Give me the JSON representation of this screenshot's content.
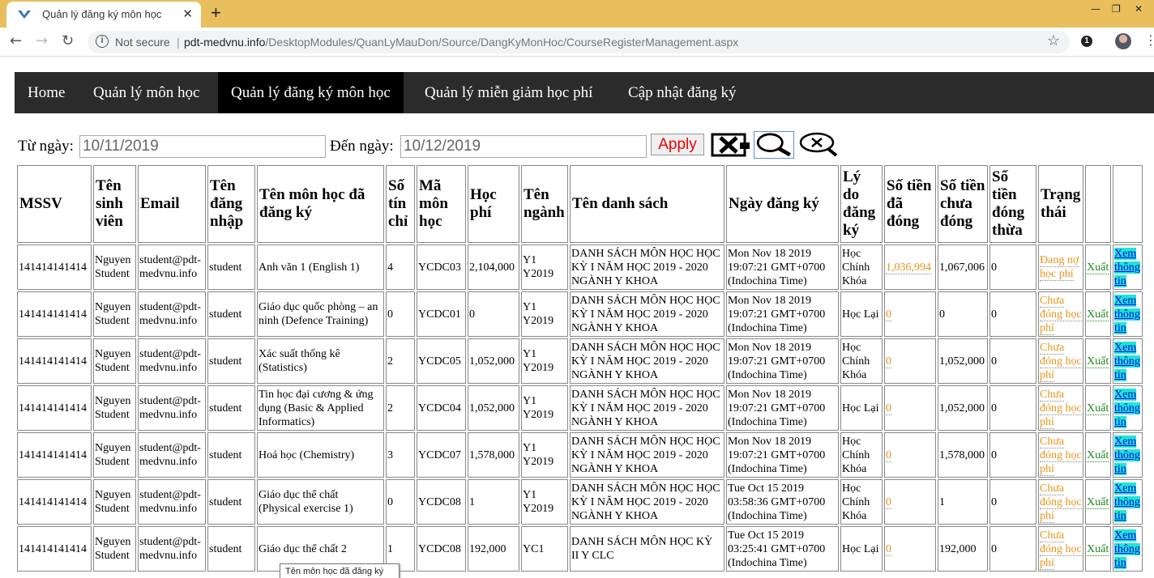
{
  "browser": {
    "tab_title": "Quản lý đăng ký môn học",
    "tab_close": "✕",
    "new_tab": "+",
    "controls": {
      "minimize": "—",
      "restore": "❐",
      "close": "✕"
    },
    "not_secure": "Not secure",
    "url_host": "pdt-medvnu.info",
    "url_path": "/DesktopModules/QuanLyMauDon/Source/DangKyMonHoc/CourseRegisterManagement.aspx",
    "extension_badge": "1"
  },
  "nav": {
    "items": [
      "Home",
      "Quản lý môn học",
      "Quản lý đăng ký môn học",
      "Quản lý miễn giảm học phí",
      "Cập nhật đăng ký"
    ],
    "active_index": 2
  },
  "filter": {
    "from_label": "Từ ngày:",
    "from_value": "10/11/2019",
    "to_label": "Đến ngày:",
    "to_value": "10/12/2019",
    "apply_label": "Apply"
  },
  "table": {
    "headers": [
      "MSSV",
      "Tên sinh viên",
      "Email",
      "Tên đăng nhập",
      "Tên môn học đã đăng ký",
      "Số tín chỉ",
      "Mã môn học",
      "Học phí",
      "Tên ngành",
      "Tên danh sách",
      "Ngày đăng ký",
      "Lý do đăng ký",
      "Số tiền đã đóng",
      "Số tiền chưa đóng",
      "Số tiền đóng thừa",
      "Trạng thái",
      "",
      ""
    ],
    "rows": [
      {
        "mssv": "141414141414",
        "name": "Nguyen Student",
        "email": "student@pdt-medvnu.info",
        "username": "student",
        "course": "Anh văn 1 (English 1)",
        "credits": "4",
        "code": "YCDC03",
        "fee": "2,104,000",
        "major": "Y1 Y2019",
        "list": "DANH SÁCH MÔN HỌC HỌC KỲ I NĂM HỌC 2019 - 2020 NGÀNH Y KHOA",
        "date": "Mon Nov 18 2019 19:07:21 GMT+0700 (Indochina Time)",
        "reason": "Học Chính Khóa",
        "paid": "1,036,994",
        "unpaid": "1,067,006",
        "overpaid": "0",
        "status": "Đang nợ học phí",
        "export": "Xuất",
        "view": "Xem thông tin"
      },
      {
        "mssv": "141414141414",
        "name": "Nguyen Student",
        "email": "student@pdt-medvnu.info",
        "username": "student",
        "course": "Giáo dục quốc phòng – an ninh (Defence Training)",
        "credits": "0",
        "code": "YCDC01",
        "fee": "0",
        "major": "Y1 Y2019",
        "list": "DANH SÁCH MÔN HỌC HỌC KỲ I NĂM HỌC 2019 - 2020 NGÀNH Y KHOA",
        "date": "Mon Nov 18 2019 19:07:21 GMT+0700 (Indochina Time)",
        "reason": "Học Lại",
        "paid": "0",
        "unpaid": "0",
        "overpaid": "0",
        "status": "Chưa đóng học phí",
        "export": "Xuất",
        "view": "Xem thông tin"
      },
      {
        "mssv": "141414141414",
        "name": "Nguyen Student",
        "email": "student@pdt-medvnu.info",
        "username": "student",
        "course": "Xác suất thống kê (Statistics)",
        "credits": "2",
        "code": "YCDC05",
        "fee": "1,052,000",
        "major": "Y1 Y2019",
        "list": "DANH SÁCH MÔN HỌC HỌC KỲ I NĂM HỌC 2019 - 2020 NGÀNH Y KHOA",
        "date": "Mon Nov 18 2019 19:07:21 GMT+0700 (Indochina Time)",
        "reason": "Học Chính Khóa",
        "paid": "0",
        "unpaid": "1,052,000",
        "overpaid": "0",
        "status": "Chưa đóng học phí",
        "export": "Xuất",
        "view": "Xem thông tin"
      },
      {
        "mssv": "141414141414",
        "name": "Nguyen Student",
        "email": "student@pdt-medvnu.info",
        "username": "student",
        "course": "Tin học đại cương & ứng dụng (Basic & Applied Informatics)",
        "credits": "2",
        "code": "YCDC04",
        "fee": "1,052,000",
        "major": "Y1 Y2019",
        "list": "DANH SÁCH MÔN HỌC HỌC KỲ I NĂM HỌC 2019 - 2020 NGÀNH Y KHOA",
        "date": "Mon Nov 18 2019 19:07:21 GMT+0700 (Indochina Time)",
        "reason": "Học Lại",
        "paid": "0",
        "unpaid": "1,052,000",
        "overpaid": "0",
        "status": "Chưa đóng học phí",
        "export": "Xuất",
        "view": "Xem thông tin"
      },
      {
        "mssv": "141414141414",
        "name": "Nguyen Student",
        "email": "student@pdt-medvnu.info",
        "username": "student",
        "course": "Hoá học (Chemistry)",
        "credits": "3",
        "code": "YCDC07",
        "fee": "1,578,000",
        "major": "Y1 Y2019",
        "list": "DANH SÁCH MÔN HỌC HỌC KỲ I NĂM HỌC 2019 - 2020 NGÀNH Y KHOA",
        "date": "Mon Nov 18 2019 19:07:21 GMT+0700 (Indochina Time)",
        "reason": "Học Chính Khóa",
        "paid": "0",
        "unpaid": "1,578,000",
        "overpaid": "0",
        "status": "Chưa đóng học phí",
        "export": "Xuất",
        "view": "Xem thông tin"
      },
      {
        "mssv": "141414141414",
        "name": "Nguyen Student",
        "email": "student@pdt-medvnu.info",
        "username": "student",
        "course": "Giáo dục thể chất (Physical exercise 1)",
        "credits": "0",
        "code": "YCDC08",
        "fee": "1",
        "major": "Y1 Y2019",
        "list": "DANH SÁCH MÔN HỌC HỌC KỲ I NĂM HỌC 2019 - 2020 NGÀNH Y KHOA",
        "date": "Tue Oct 15 2019 03:58:36 GMT+0700 (Indochina Time)",
        "reason": "Học Chính Khóa",
        "paid": "0",
        "unpaid": "1",
        "overpaid": "0",
        "status": "Chưa đóng học phí",
        "export": "Xuất",
        "view": "Xem thông tin"
      },
      {
        "mssv": "141414141414",
        "name": "Nguyen Student",
        "email": "student@pdt-medvnu.info",
        "username": "student",
        "course": "Giáo dục thể chất 2",
        "credits": "1",
        "code": "YCDC08",
        "fee": "192,000",
        "major": "YC1",
        "list": "DANH SÁCH MÔN HỌC KỲ II Y CLC",
        "date": "Tue Oct 15 2019 03:25:41 GMT+0700 (Indochina Time)",
        "reason": "Học Lại",
        "paid": "0",
        "unpaid": "192,000",
        "overpaid": "0",
        "status": "Chưa đóng học phí",
        "export": "Xuất",
        "view": "Xem thông tin"
      }
    ]
  },
  "tooltip": "Tên môn học đã đăng ký",
  "colors": {
    "tab_strip": "#e8bf5c",
    "nav_bg": "#2b2b2b",
    "nav_active": "#000000",
    "status_orange": "#e8941a",
    "export_green": "#1a8a1a",
    "view_highlight": "#20e6d0"
  }
}
